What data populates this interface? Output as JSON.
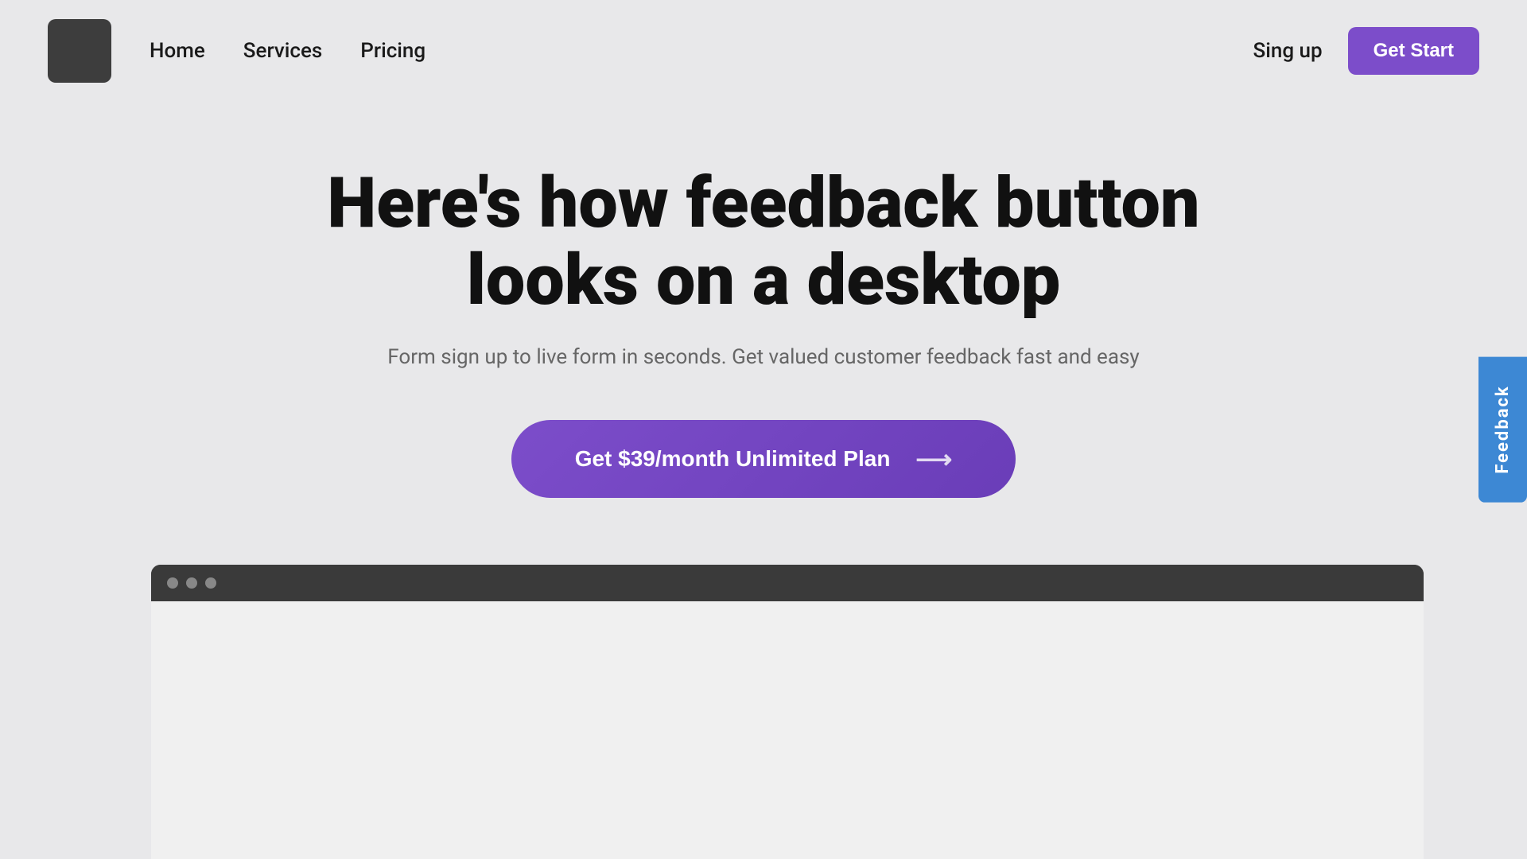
{
  "navbar": {
    "logo_alt": "Logo",
    "nav_links": [
      {
        "id": "home",
        "label": "Home"
      },
      {
        "id": "services",
        "label": "Services"
      },
      {
        "id": "pricing",
        "label": "Pricing"
      }
    ],
    "sign_up_label": "Sing up",
    "get_start_label": "Get Start"
  },
  "hero": {
    "title": "Here's how feedback button looks on a desktop",
    "subtitle": "Form sign up to live form in seconds. Get valued customer feedback fast and easy",
    "cta_label": "Get $39/month Unlimited Plan",
    "cta_arrow": "⟶"
  },
  "browser": {
    "dots": [
      "dot1",
      "dot2",
      "dot3"
    ]
  },
  "feedback": {
    "label": "Feedback"
  },
  "colors": {
    "brand_purple": "#7c4dca",
    "brand_blue": "#3d88d4",
    "logo_bg": "#3d3d3d",
    "bg": "#e8e8ea",
    "text_dark": "#111111",
    "text_muted": "#666666",
    "browser_bar": "#3a3a3a"
  }
}
